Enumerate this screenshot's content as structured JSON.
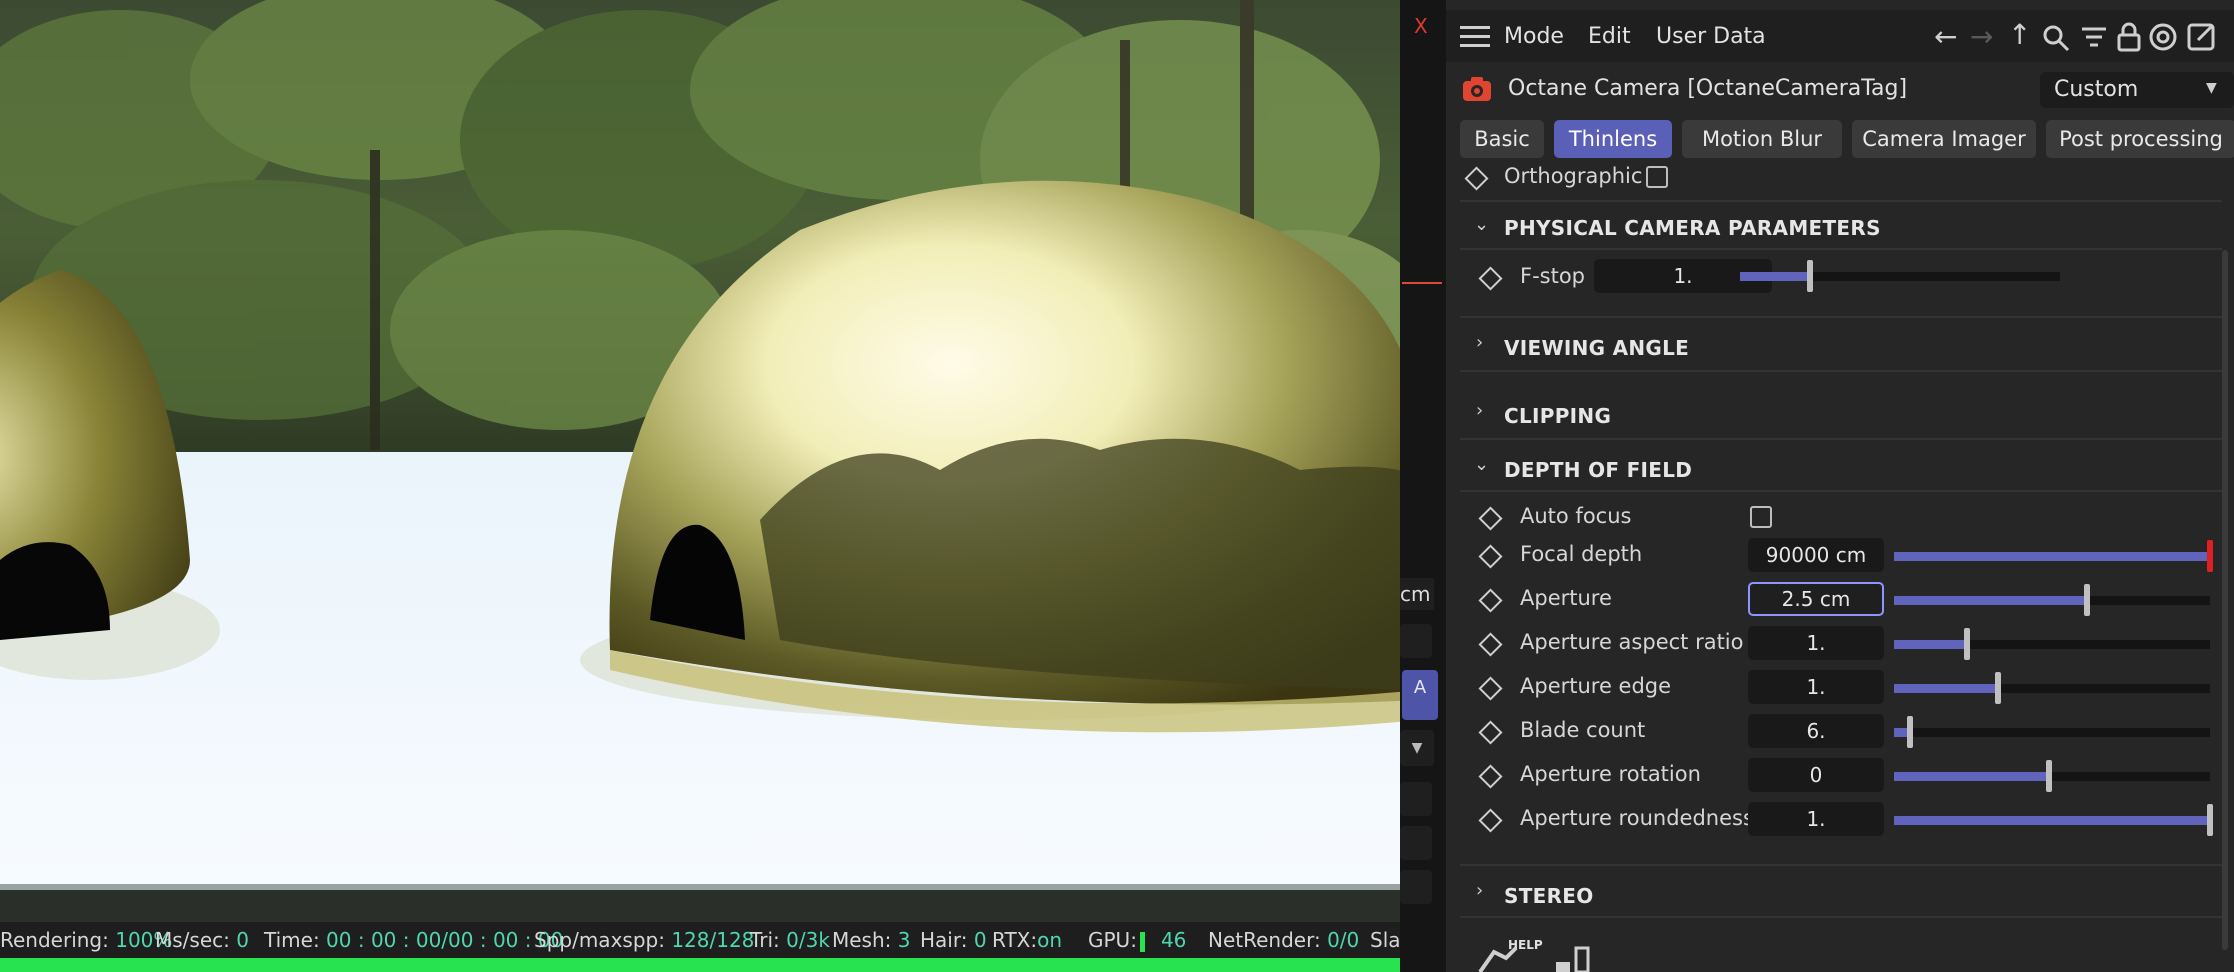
{
  "viewport": {
    "side_marker": "X",
    "side_unit": "cm",
    "side_button": "A",
    "status": {
      "rendering_label": "Rendering:",
      "rendering_value": "100%",
      "mssec_label": "Ms/sec:",
      "mssec_value": "0",
      "time_label": "Time:",
      "time_value": "00 : 00 : 00/00 : 00 : 00",
      "spp_label": "Spp/maxspp:",
      "spp_value": "128/128",
      "tri_label": "Tri:",
      "tri_value": "0/3k",
      "mesh_label": "Mesh:",
      "mesh_value": "3",
      "hair_label": "Hair:",
      "hair_value": "0",
      "rtx_label": "RTX:",
      "rtx_value": "on",
      "gpu_label": "GPU:",
      "gpu_value": "46",
      "netrender_label": "NetRender:",
      "netrender_value": "0/0",
      "slave_label": "Slav"
    },
    "progress": 1.0
  },
  "panel": {
    "menu": [
      "Mode",
      "Edit",
      "User Data"
    ],
    "object_name": "Octane Camera [OctaneCameraTag]",
    "preset_value": "Custom",
    "tabs": [
      "Basic",
      "Thinlens",
      "Motion Blur",
      "Camera Imager",
      "Post processing"
    ],
    "active_tab": "Thinlens",
    "orthographic_label": "Orthographic",
    "sections": {
      "physical": "PHYSICAL CAMERA PARAMETERS",
      "viewing": "VIEWING ANGLE",
      "clipping": "CLIPPING",
      "dof": "DEPTH OF FIELD",
      "stereo": "STEREO"
    },
    "fstop": {
      "label": "F-stop",
      "value": "1.",
      "level": 0.22
    },
    "dof": {
      "auto_focus_label": "Auto focus",
      "params": [
        {
          "label": "Focal depth",
          "value": "90000 cm",
          "level": 1.0
        },
        {
          "label": "Aperture",
          "value": "2.5 cm",
          "level": 0.61
        },
        {
          "label": "Aperture aspect ratio",
          "value": "1.",
          "level": 0.23
        },
        {
          "label": "Aperture edge",
          "value": "1.",
          "level": 0.33
        },
        {
          "label": "Blade count",
          "value": "6.",
          "level": 0.05
        },
        {
          "label": "Aperture rotation",
          "value": "0",
          "level": 0.49
        },
        {
          "label": "Aperture roundedness",
          "value": "1.",
          "level": 1.0
        }
      ]
    },
    "help_label": "HELP",
    "colors": {
      "accent": "#5a5fb7",
      "slider": "#6064bd",
      "status_value": "#4fd6b0",
      "progress": "#27e34f",
      "camera_icon": "#e0452f"
    }
  }
}
